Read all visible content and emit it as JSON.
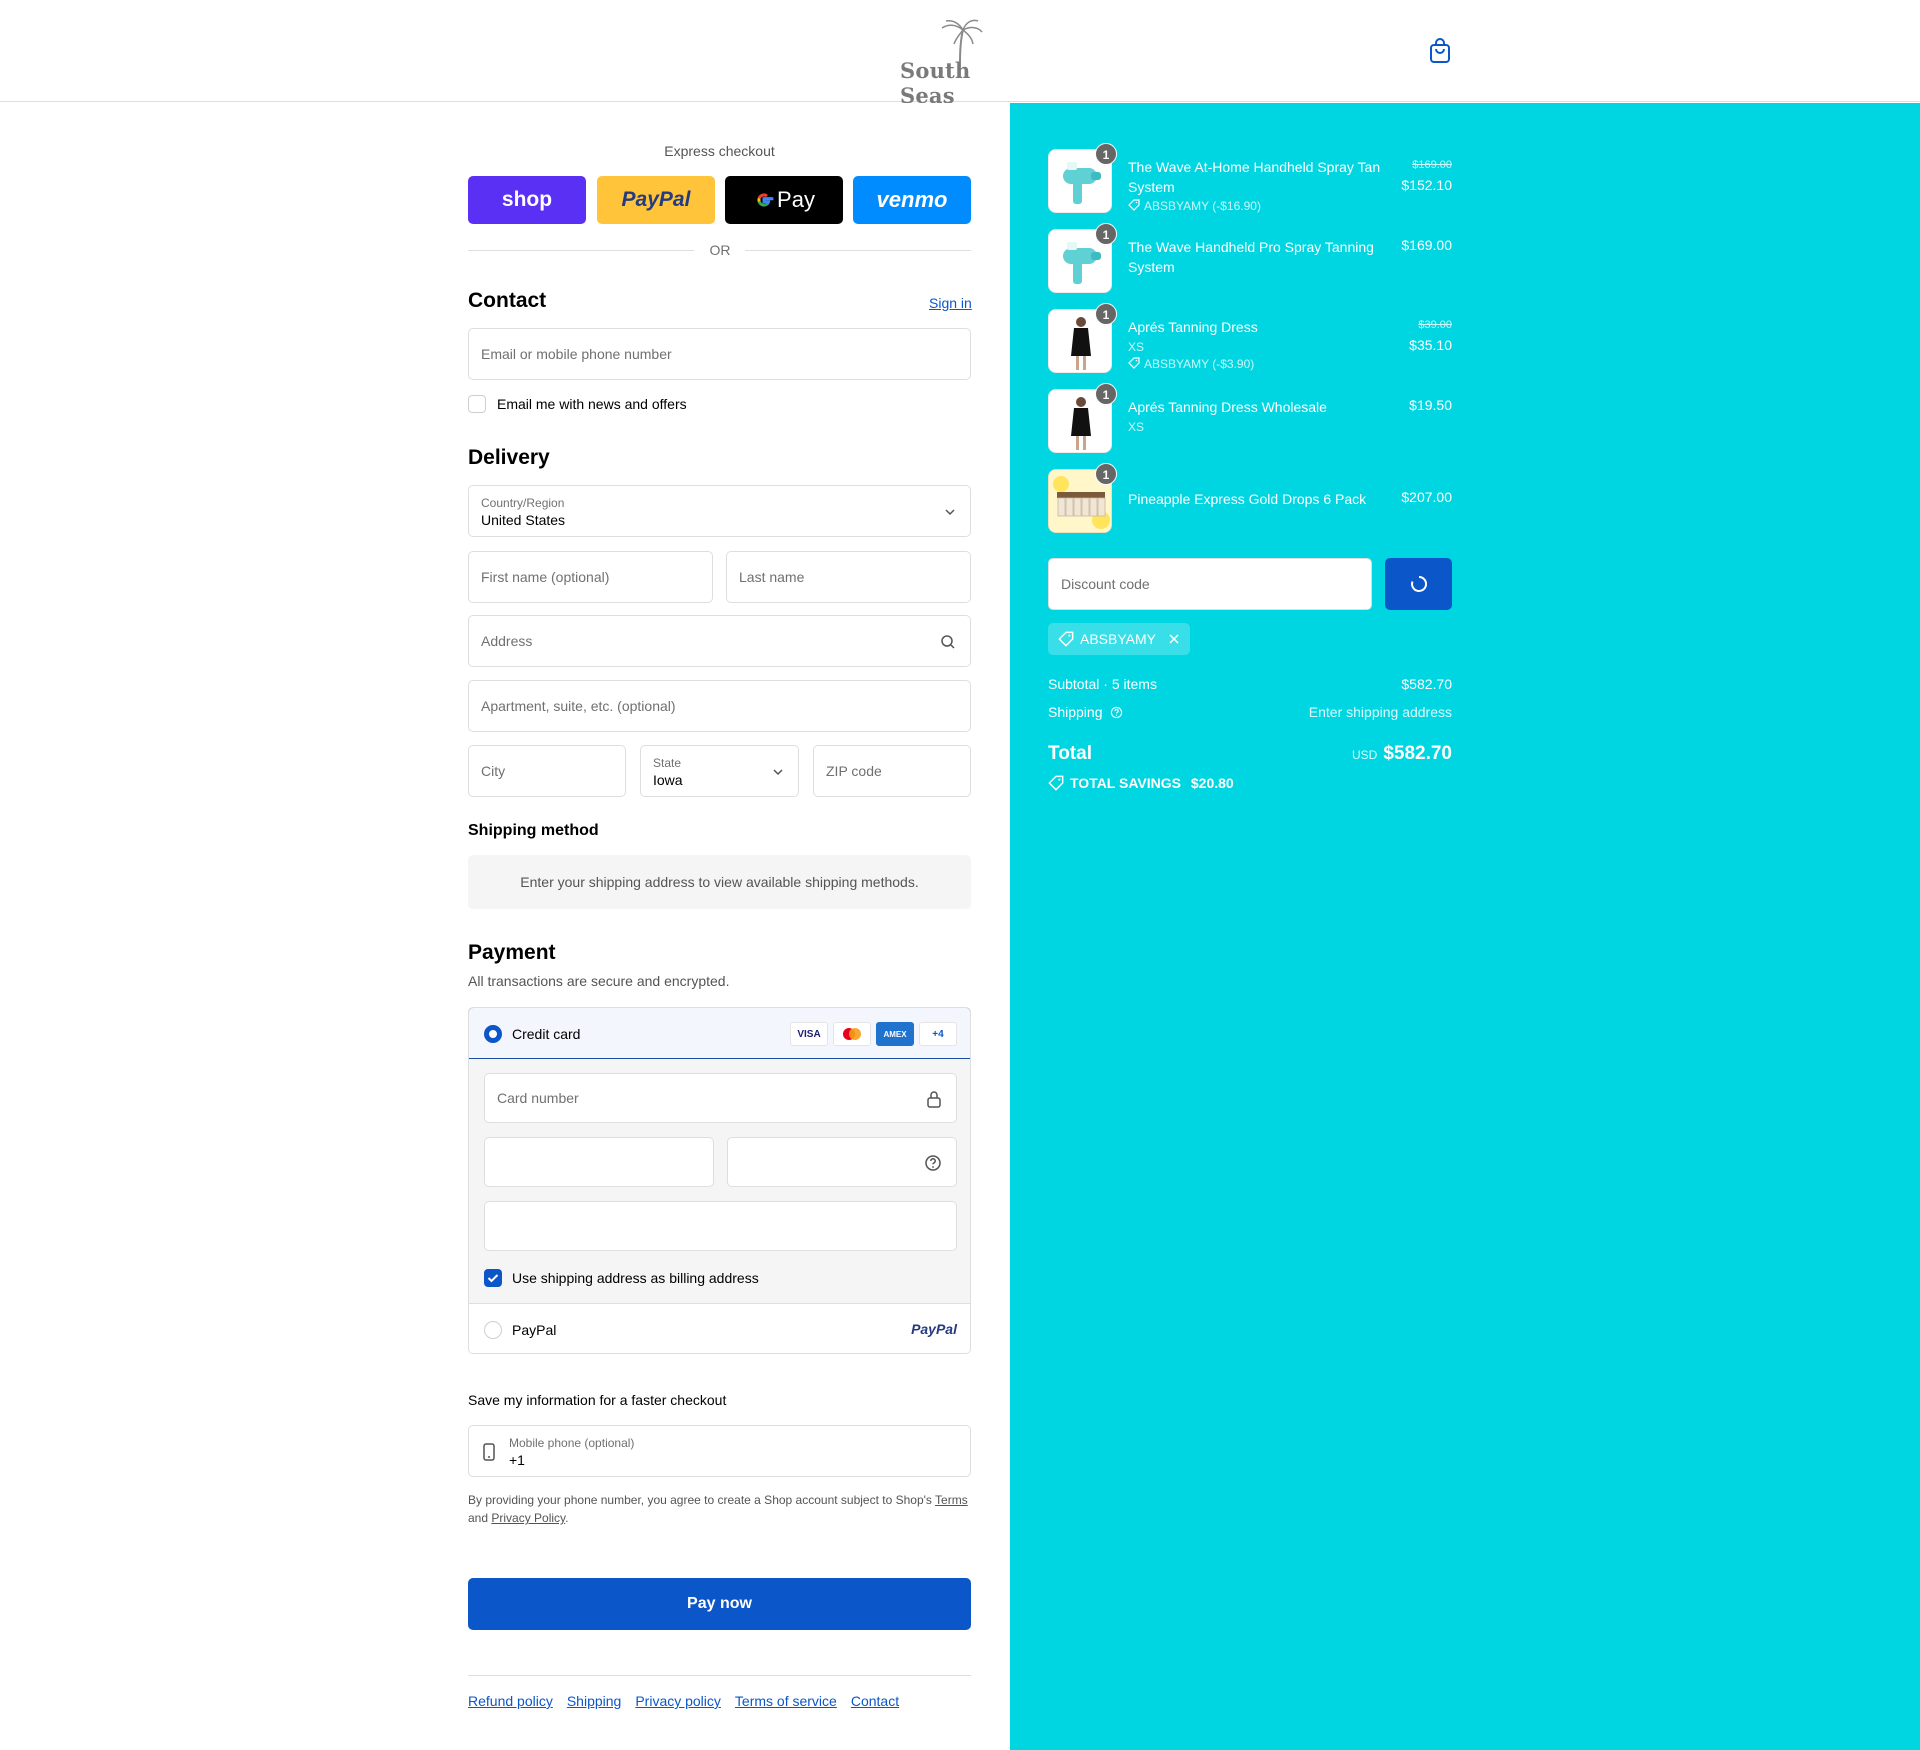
{
  "brand": {
    "name": "South Seas"
  },
  "express": {
    "title": "Express checkout",
    "shop_label": "shop",
    "paypal_label": "PayPal",
    "gpay_label": "Pay",
    "venmo_label": "venmo",
    "or_label": "OR"
  },
  "contact": {
    "title": "Contact",
    "sign_in": "Sign in",
    "email_placeholder": "Email or mobile phone number",
    "newsletter_label": "Email me with news and offers"
  },
  "delivery": {
    "title": "Delivery",
    "country_label": "Country/Region",
    "country_value": "United States",
    "first_name_placeholder": "First name (optional)",
    "last_name_placeholder": "Last name",
    "address_placeholder": "Address",
    "apartment_placeholder": "Apartment, suite, etc. (optional)",
    "city_placeholder": "City",
    "state_label": "State",
    "state_value": "Iowa",
    "zip_placeholder": "ZIP code"
  },
  "shipping_method": {
    "title": "Shipping method",
    "note": "Enter your shipping address to view available shipping methods."
  },
  "payment": {
    "title": "Payment",
    "subtitle": "All transactions are secure and encrypted.",
    "credit_card_label": "Credit card",
    "card_badges": [
      "VISA",
      "",
      "AMEX",
      "+4"
    ],
    "card_number_placeholder": "Card number",
    "billing_same_label": "Use shipping address as billing address",
    "paypal_label": "PayPal",
    "paypal_logo": "PayPal"
  },
  "save_info": {
    "title": "Save my information for a faster checkout",
    "phone_label": "Mobile phone (optional)",
    "phone_value": "+1",
    "disclaimer_prefix": "By providing your phone number, you agree to create a Shop account subject to Shop's ",
    "terms_link": "Terms",
    "disclaimer_and": "and ",
    "privacy_link": "Privacy Policy",
    "disclaimer_end": "."
  },
  "pay_now_label": "Pay now",
  "footer_links": [
    "Refund policy",
    "Shipping",
    "Privacy policy",
    "Terms of service",
    "Contact"
  ],
  "order": {
    "items": [
      {
        "qty": "1",
        "name": "The Wave At-Home Handheld Spray Tan System",
        "sub": "ABSBYAMY (-$16.90)",
        "old_price": "$169.00",
        "price": "$152.10"
      },
      {
        "qty": "1",
        "name": "The Wave Handheld Pro Spray Tanning System",
        "sub": "",
        "old_price": "",
        "price": "$169.00"
      },
      {
        "qty": "1",
        "name": "Aprés Tanning Dress",
        "variant": "XS",
        "sub": "ABSBYAMY (-$3.90)",
        "old_price": "$39.00",
        "price": "$35.10"
      },
      {
        "qty": "1",
        "name": "Aprés Tanning Dress Wholesale",
        "variant": "XS",
        "sub": "",
        "old_price": "",
        "price": "$19.50"
      },
      {
        "qty": "1",
        "name": "Pineapple Express Gold Drops 6 Pack",
        "sub": "",
        "old_price": "",
        "price": "$207.00"
      }
    ],
    "discount_placeholder": "Discount code",
    "applied_code": "ABSBYAMY",
    "subtotal_label": "Subtotal · 5 items",
    "subtotal_value": "$582.70",
    "shipping_label": "Shipping",
    "shipping_value": "Enter shipping address",
    "total_label": "Total",
    "currency": "USD",
    "total_value": "$582.70",
    "savings_label": "TOTAL SAVINGS",
    "savings_value": "$20.80"
  },
  "colors": {
    "accent": "#0b56c9",
    "sidebar_bg": "#00d6e2",
    "shop_purple": "#5a31f4",
    "paypal_yellow": "#ffc439",
    "venmo_blue": "#008cff"
  }
}
